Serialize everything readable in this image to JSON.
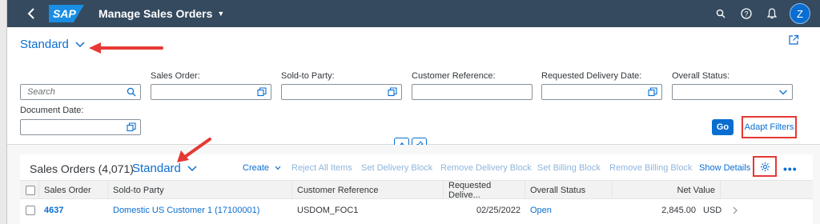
{
  "shell": {
    "app_title": "Manage Sales Orders",
    "avatar_initial": "Z",
    "logo_text": "SAP"
  },
  "filter_bar": {
    "variant_name": "Standard",
    "search_placeholder": "Search",
    "fields": {
      "sales_order": "Sales Order:",
      "sold_to_party": "Sold-to Party:",
      "customer_reference": "Customer Reference:",
      "requested_delivery_date": "Requested Delivery Date:",
      "overall_status": "Overall Status:",
      "document_date": "Document Date:"
    },
    "go_label": "Go",
    "adapt_filters_label": "Adapt Filters"
  },
  "table": {
    "title": "Sales Orders (4,071)",
    "variant_name": "Standard",
    "toolbar": {
      "create": "Create",
      "reject_all_items": "Reject All Items",
      "set_delivery_block": "Set Delivery Block",
      "remove_delivery_block": "Remove Delivery Block",
      "set_billing_block": "Set Billing Block",
      "remove_billing_block": "Remove Billing Block",
      "show_details": "Show Details"
    },
    "columns": [
      "Sales Order",
      "Sold-to Party",
      "Customer Reference",
      "Requested Delive...",
      "Overall Status",
      "Net Value"
    ],
    "rows": [
      {
        "sales_order": "4637",
        "sold_to_party": "Domestic US Customer 1 (17100001)",
        "customer_reference": "USDOM_FOC1",
        "requested_delivery": "02/25/2022",
        "overall_status": "Open",
        "net_value": "2,845.00",
        "currency": "USD"
      }
    ]
  },
  "colors": {
    "shell_bg": "#354a5f",
    "accent": "#0a6ed1",
    "annotation_red": "#e53935"
  }
}
